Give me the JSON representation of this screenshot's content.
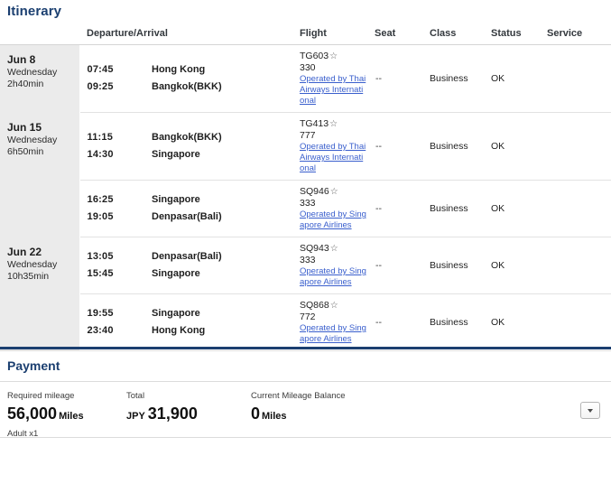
{
  "itinerary": {
    "title": "Itinerary",
    "columns": {
      "date": "",
      "departure_arrival": "Departure/Arrival",
      "flight": "Flight",
      "seat": "Seat",
      "class": "Class",
      "status": "Status",
      "service": "Service"
    },
    "segments": [
      {
        "date": {
          "day": "Jun 8",
          "weekday": "Wednesday",
          "duration": "2h40min"
        },
        "depart_time": "07:45",
        "arrive_time": "09:25",
        "depart_city": "Hong Kong",
        "arrive_city": "Bangkok(BKK)",
        "flight_no": "TG603",
        "star": "☆",
        "equipment": "330",
        "operated_by": "Operated by Thai Airways International",
        "seat": "--",
        "class": "Business",
        "status": "OK",
        "service": ""
      },
      {
        "date": {
          "day": "Jun 15",
          "weekday": "Wednesday",
          "duration": "6h50min"
        },
        "depart_time": "11:15",
        "arrive_time": "14:30",
        "depart_city": "Bangkok(BKK)",
        "arrive_city": "Singapore",
        "flight_no": "TG413",
        "star": "☆",
        "equipment": "777",
        "operated_by": "Operated by Thai Airways International",
        "seat": "--",
        "class": "Business",
        "status": "OK",
        "service": ""
      },
      {
        "date": {
          "day": "",
          "weekday": "",
          "duration": ""
        },
        "depart_time": "16:25",
        "arrive_time": "19:05",
        "depart_city": "Singapore",
        "arrive_city": "Denpasar(Bali)",
        "flight_no": "SQ946",
        "star": "☆",
        "equipment": "333",
        "operated_by": "Operated by Singapore Airlines",
        "seat": "--",
        "class": "Business",
        "status": "OK",
        "service": ""
      },
      {
        "date": {
          "day": "Jun 22",
          "weekday": "Wednesday",
          "duration": "10h35min"
        },
        "depart_time": "13:05",
        "arrive_time": "15:45",
        "depart_city": "Denpasar(Bali)",
        "arrive_city": "Singapore",
        "flight_no": "SQ943",
        "star": "☆",
        "equipment": "333",
        "operated_by": "Operated by Singapore Airlines",
        "seat": "--",
        "class": "Business",
        "status": "OK",
        "service": ""
      },
      {
        "date": {
          "day": "",
          "weekday": "",
          "duration": ""
        },
        "depart_time": "19:55",
        "arrive_time": "23:40",
        "depart_city": "Singapore",
        "arrive_city": "Hong Kong",
        "flight_no": "SQ868",
        "star": "☆",
        "equipment": "772",
        "operated_by": "Operated by Singapore Airlines",
        "seat": "--",
        "class": "Business",
        "status": "OK",
        "service": ""
      }
    ]
  },
  "payment": {
    "title": "Payment",
    "required_mileage_label": "Required mileage",
    "required_mileage_value": "56,000",
    "required_mileage_unit": "Miles",
    "passengers": "Adult x1",
    "total_label": "Total",
    "total_currency": "JPY",
    "total_value": "31,900",
    "balance_label": "Current Mileage Balance",
    "balance_value": "0",
    "balance_unit": "Miles",
    "dropdown_icon": "chevron-down-icon"
  },
  "colors": {
    "heading": "#1b3f70",
    "link": "#3a5fcd",
    "date_bg": "#ebebeb",
    "rule": "#1b3f70"
  }
}
